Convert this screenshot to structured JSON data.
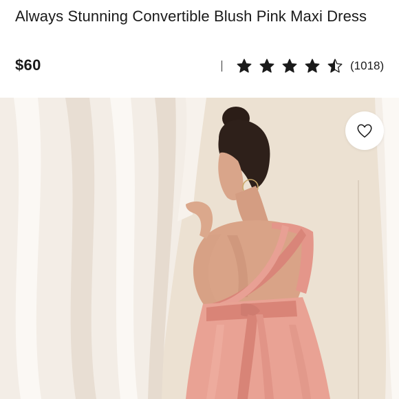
{
  "product": {
    "title": "Always Stunning Convertible Blush Pink Maxi Dress",
    "price": "$60"
  },
  "rating": {
    "stars": 4.5,
    "max_stars": 5,
    "count_text": "(1018)"
  },
  "icons": {
    "favorite": "heart-outline-icon",
    "star": "star-icon"
  },
  "colors": {
    "dress": "#e9a294",
    "text": "#1a1a1a"
  }
}
